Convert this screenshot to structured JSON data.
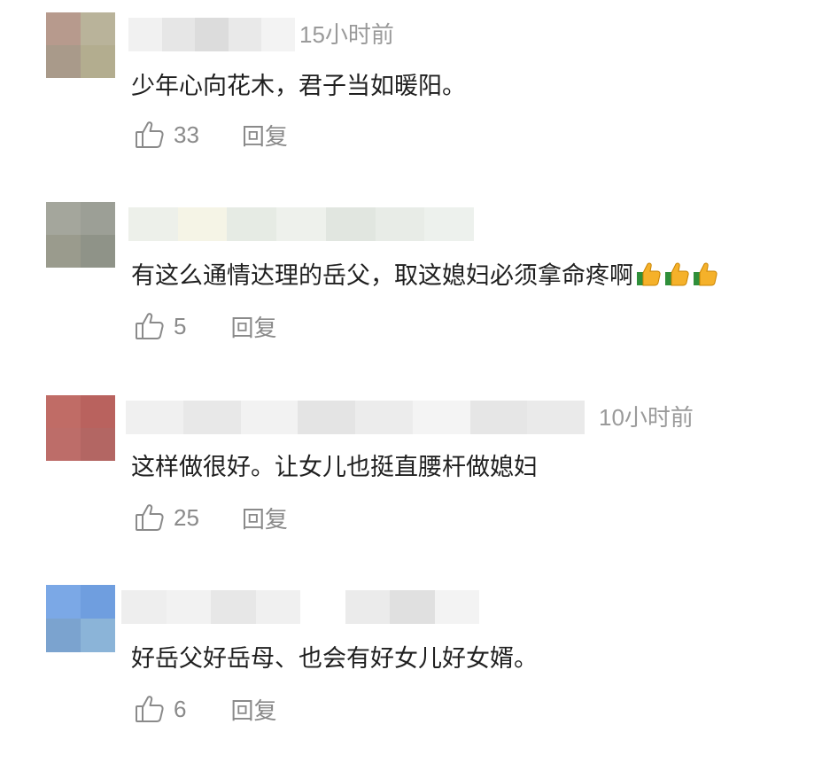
{
  "comments": [
    {
      "time": "15小时前",
      "text": "少年心向花木，君子当如暖阳。",
      "likes": "33",
      "reply_label": "回复",
      "avatar_colors": [
        "#b79a8d",
        "#b9b39a",
        "#a99a8a",
        "#b3ad8f"
      ],
      "name_colors": [
        "#f1f1f1",
        "#e6e6e6",
        "#dcdcdc",
        "#e9e9e9",
        "#f3f3f3"
      ]
    },
    {
      "time": "",
      "text": "有这么通情达理的岳父，取这媳妇必须拿命疼啊",
      "emoji_count": 3,
      "likes": "5",
      "reply_label": "回复",
      "avatar_colors": [
        "#a4a69c",
        "#9c9f96",
        "#9a9b8d",
        "#8f9388"
      ],
      "name_colors": [
        "#edf0ea",
        "#f5f4e6",
        "#e6ebe4",
        "#eef1ec",
        "#e1e6e0",
        "#e8ece7",
        "#edf1ed"
      ]
    },
    {
      "time": "10小时前",
      "text": "这样做很好。让女儿也挺直腰杆做媳妇",
      "likes": "25",
      "reply_label": "回复",
      "avatar_colors": [
        "#c06c66",
        "#b9625e",
        "#bd6d69",
        "#b36663"
      ],
      "name_colors": [
        "#f0f0f0",
        "#e8e8e8",
        "#f2f2f2",
        "#e4e4e4",
        "#ececec",
        "#f4f4f4",
        "#e6e6e6",
        "#eaeaea"
      ]
    },
    {
      "time": "",
      "text": "好岳父好岳母、也会有好女儿好女婿。",
      "likes": "6",
      "reply_label": "回复",
      "avatar_colors": [
        "#7ba8e6",
        "#6f9edf",
        "#7ba3cf",
        "#8bb4d8"
      ],
      "name_colors": [
        "#eeeeee",
        "#f2f2f2",
        "#e7e7e7",
        "#f0f0f0",
        "#ffffff",
        "#ebebeb",
        "#e0e0e0",
        "#f3f3f3"
      ]
    }
  ]
}
